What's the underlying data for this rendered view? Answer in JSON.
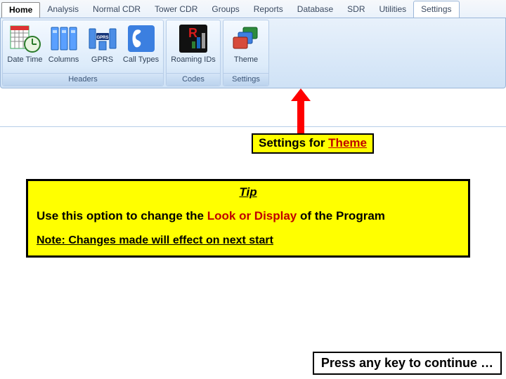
{
  "tabs": {
    "home": "Home",
    "items": [
      "Analysis",
      "Normal CDR",
      "Tower CDR",
      "Groups",
      "Reports",
      "Database",
      "SDR",
      "Utilities",
      "Settings"
    ],
    "active_index": 8
  },
  "ribbon": {
    "groups": [
      {
        "caption": "Headers",
        "buttons": [
          {
            "label": "Date Time",
            "icon": "datetime-icon"
          },
          {
            "label": "Columns",
            "icon": "columns-icon"
          },
          {
            "label": "GPRS",
            "icon": "gprs-icon"
          },
          {
            "label": "Call Types",
            "icon": "calltypes-icon"
          }
        ]
      },
      {
        "caption": "Codes",
        "buttons": [
          {
            "label": "Roaming IDs",
            "icon": "roaming-icon"
          }
        ]
      },
      {
        "caption": "Settings",
        "buttons": [
          {
            "label": "Theme",
            "icon": "theme-icon",
            "highlight": true
          }
        ]
      }
    ]
  },
  "callout": {
    "prefix": "Settings for ",
    "link": "Theme"
  },
  "tip": {
    "title": "Tip",
    "line_pre": "Use this option to change the ",
    "line_red": "Look or Display ",
    "line_post": "of the Program",
    "note": "Note: Changes made will effect on next start"
  },
  "continue": "Press any key to continue …"
}
